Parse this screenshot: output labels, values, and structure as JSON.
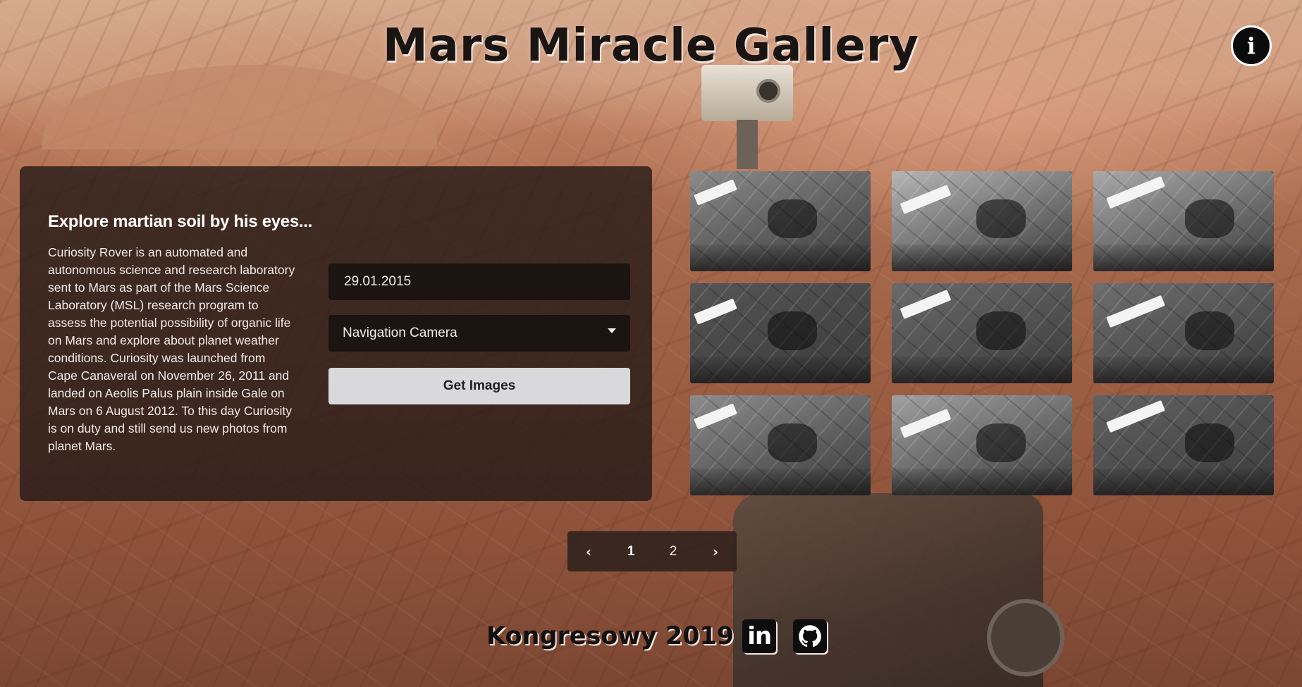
{
  "header": {
    "title": "Mars Miracle Gallery",
    "info_icon": "info-icon",
    "info_glyph": "i"
  },
  "panel": {
    "heading": "Explore martian soil by his eyes...",
    "description": "Curiosity Rover is an automated and autonomous science and research laboratory sent to Mars as part of the Mars Science Laboratory (MSL) research program to assess the potential possibility of organic life on Mars and explore about planet weather conditions. Curiosity was launched from Cape Canaveral on November 26, 2011 and landed on Aeolis Palus plain inside Gale on Mars on 6 August 2012. To this day Curiosity is on duty and still send us new photos from planet Mars.",
    "date_value": "29.01.2015",
    "camera_selected": "Navigation Camera",
    "get_button_label": "Get Images"
  },
  "gallery": {
    "thumbnails": [
      {
        "tone": "#8a8a8a"
      },
      {
        "tone": "#b5b5b5"
      },
      {
        "tone": "#a9a9a9"
      },
      {
        "tone": "#555555"
      },
      {
        "tone": "#6a6a6a"
      },
      {
        "tone": "#6e6e6e"
      },
      {
        "tone": "#8c8c8c"
      },
      {
        "tone": "#a0a0a0"
      },
      {
        "tone": "#626262"
      }
    ]
  },
  "pagination": {
    "prev_icon": "chevron-left-icon",
    "prev_glyph": "‹",
    "pages": [
      "1",
      "2"
    ],
    "active_page": "1",
    "next_icon": "chevron-right-icon",
    "next_glyph": "›"
  },
  "footer": {
    "text": "Kongresowy 2019",
    "linkedin_icon": "linkedin-icon",
    "linkedin_glyph": "in",
    "github_icon": "github-icon"
  },
  "colors": {
    "panel_bg": "#281c18",
    "button_bg": "#d9d9db",
    "input_bg": "#1b1411",
    "title_color": "#1a1412"
  }
}
